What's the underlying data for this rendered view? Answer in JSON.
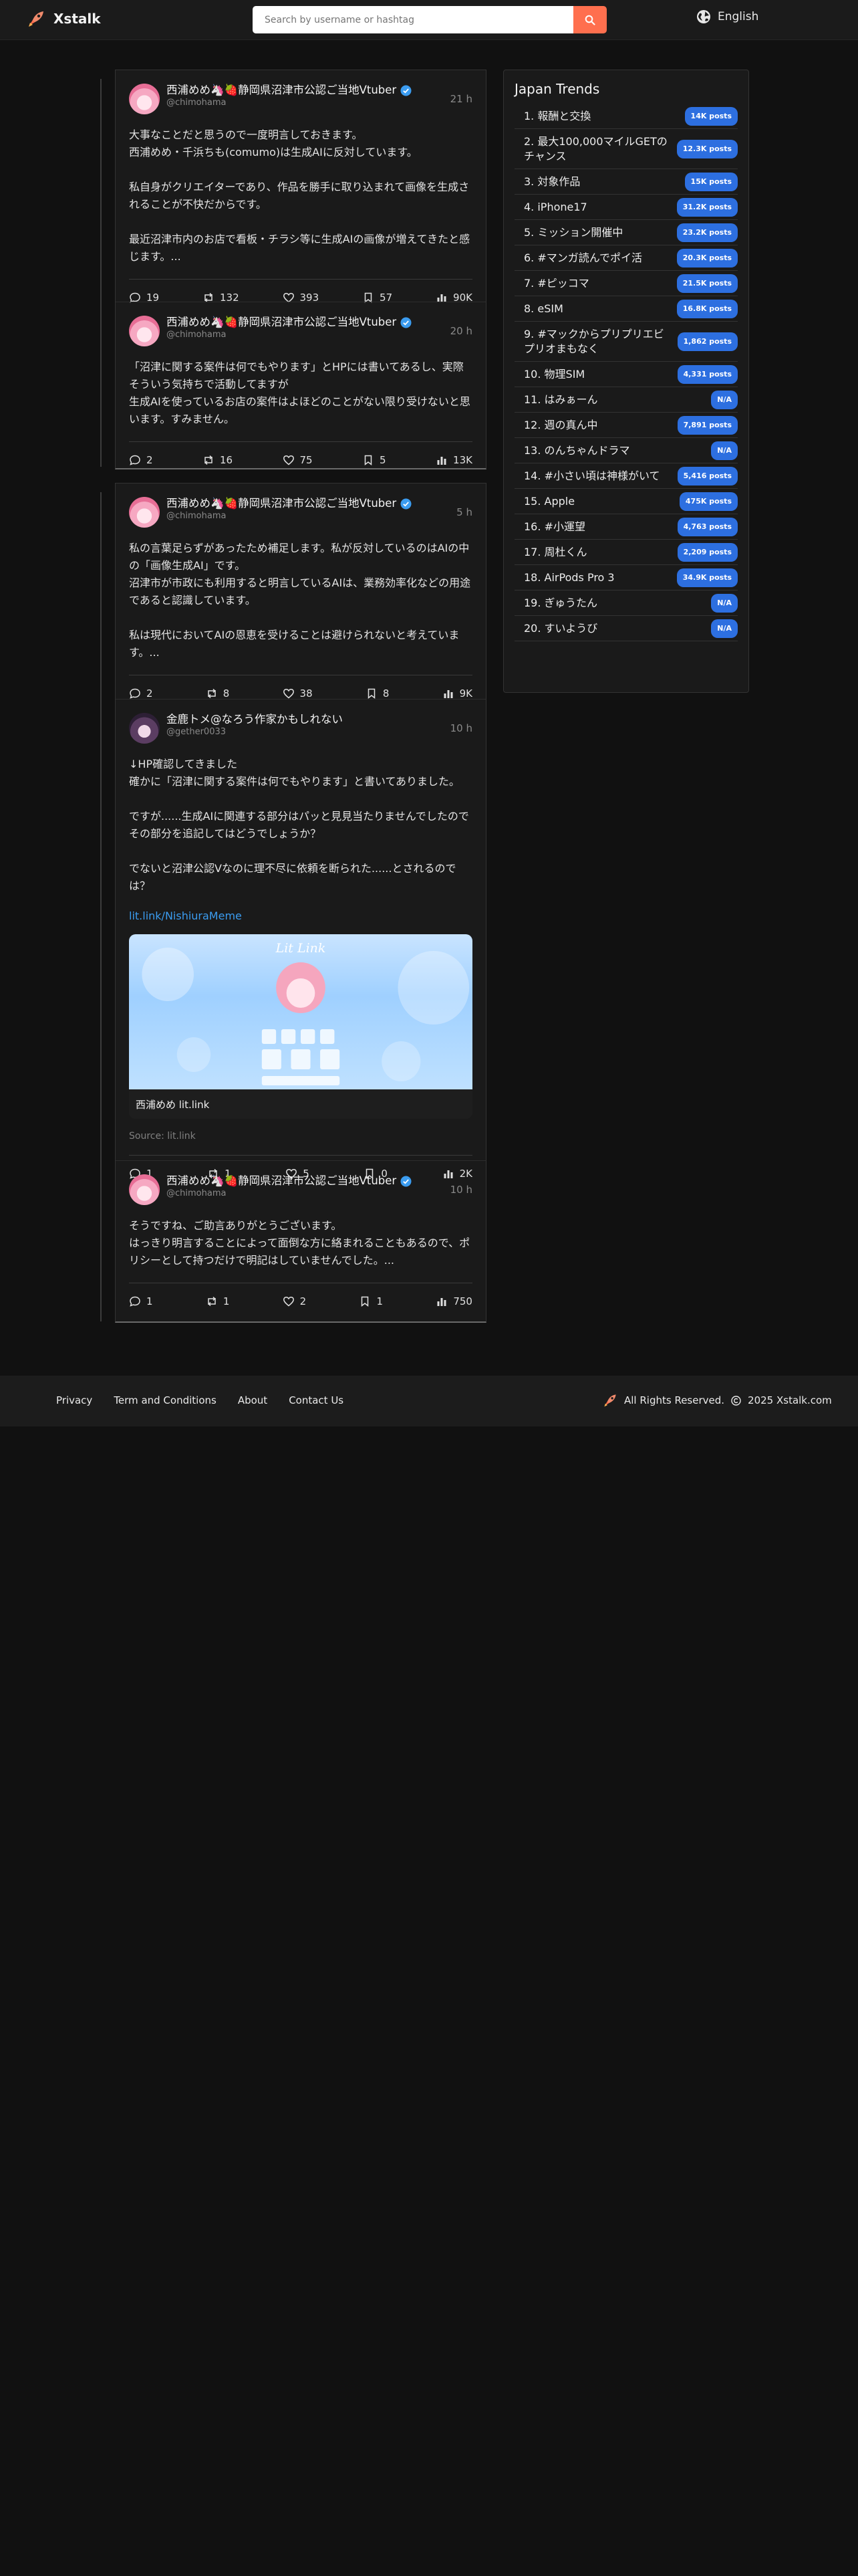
{
  "header": {
    "logo_text": "Xstalk",
    "search_placeholder": "Search by username or hashtag",
    "language": "English"
  },
  "threads": [
    {
      "posts": [
        {
          "name": "西浦めめ🦄🍓静岡県沼津市公認ご当地Vtuber",
          "handle": "@chimohama",
          "time": "21 h",
          "body": "大事なことだと思うので一度明言しておきます。\n西浦めめ・千浜ちも(comumo)は生成AIに反対しています。\n\n私自身がクリエイターであり、作品を勝手に取り込まれて画像を生成されることが不快だからです。\n\n最近沼津市内のお店で看板・チラシ等に生成AIの画像が増えてきたと感じます。...",
          "replies": "19",
          "reposts": "132",
          "likes": "393",
          "bookmarks": "57",
          "views": "90K"
        },
        {
          "name": "西浦めめ🦄🍓静岡県沼津市公認ご当地Vtuber",
          "handle": "@chimohama",
          "time": "20 h",
          "body": "「沼津に関する案件は何でもやります」とHPには書いてあるし、実際そういう気持ちで活動してますが\n生成AIを使っているお店の案件はよほどのことがない限り受けないと思います。すみません。",
          "replies": "2",
          "reposts": "16",
          "likes": "75",
          "bookmarks": "5",
          "views": "13K"
        }
      ]
    },
    {
      "posts": [
        {
          "name": "西浦めめ🦄🍓静岡県沼津市公認ご当地Vtuber",
          "handle": "@chimohama",
          "time": "5 h",
          "body": "私の言葉足らずがあったため補足します。私が反対しているのはAIの中の「画像生成AI」です。\n沼津市が市政にも利用すると明言しているAIは、業務効率化などの用途であると認識しています。\n\n私は現代においてAIの恩恵を受けることは避けられないと考えています。...",
          "replies": "2",
          "reposts": "8",
          "likes": "38",
          "bookmarks": "8",
          "views": "9K"
        },
        {
          "name": "金鹿トメ@なろう作家かもしれない",
          "handle": "@gether0033",
          "time": "10 h",
          "body": "↓HP確認してきました\n確かに「沼津に関する案件は何でもやります」と書いてありました。\n\nですが......生成AIに関連する部分はパッと見見当たりませんでしたのでその部分を追記してはどうでしょうか？\n\nでないと沼津公認Vなのに理不尽に依頼を断られた......とされるのでは？",
          "link": "lit.link/NishiuraMeme",
          "preview_caption": "西浦めめ lit.link",
          "preview_brand": "Lit Link",
          "source": "Source: lit.link",
          "replies": "1",
          "reposts": "1",
          "likes": "5",
          "bookmarks": "0",
          "views": "2K"
        },
        {
          "name": "西浦めめ🦄🍓静岡県沼津市公認ご当地Vtuber",
          "handle": "@chimohama",
          "time": "10 h",
          "body": "そうですね、ご助言ありがとうございます。\nはっきり明言することによって面倒な方に絡まれることもあるので、ポリシーとして持つだけで明記はしていませんでした。...",
          "replies": "1",
          "reposts": "1",
          "likes": "2",
          "bookmarks": "1",
          "views": "750"
        }
      ]
    }
  ],
  "trends": {
    "title": "Japan Trends",
    "items": [
      {
        "label": "1. 報酬と交換",
        "count": "14K posts"
      },
      {
        "label": "2. 最大100,000マイルGETのチャンス",
        "count": "12.3K posts"
      },
      {
        "label": "3. 対象作品",
        "count": "15K posts"
      },
      {
        "label": "4. iPhone17",
        "count": "31.2K posts"
      },
      {
        "label": "5. ミッション開催中",
        "count": "23.2K posts"
      },
      {
        "label": "6. #マンガ読んでポイ活",
        "count": "20.3K posts"
      },
      {
        "label": "7. #ピッコマ",
        "count": "21.5K posts"
      },
      {
        "label": "8. eSIM",
        "count": "16.8K posts"
      },
      {
        "label": "9. #マックからプリプリエビプリオまもなく",
        "count": "1,862 posts"
      },
      {
        "label": "10. 物理SIM",
        "count": "4,331 posts"
      },
      {
        "label": "11. はみぁーん",
        "count": "N/A"
      },
      {
        "label": "12. 週の真ん中",
        "count": "7,891 posts"
      },
      {
        "label": "13. のんちゃんドラマ",
        "count": "N/A"
      },
      {
        "label": "14. #小さい頃は神様がいて",
        "count": "5,416 posts"
      },
      {
        "label": "15. Apple",
        "count": "475K posts"
      },
      {
        "label": "16. #小運望",
        "count": "4,763 posts"
      },
      {
        "label": "17. 周杜くん",
        "count": "2,209 posts"
      },
      {
        "label": "18. AirPods Pro 3",
        "count": "34.9K posts"
      },
      {
        "label": "19. ぎゅうたん",
        "count": "N/A"
      },
      {
        "label": "20. すいようび",
        "count": "N/A"
      }
    ]
  },
  "footer": {
    "links": [
      "Privacy",
      "Term and Conditions",
      "About",
      "Contact Us"
    ],
    "copyright": "All Rights Reserved.",
    "copyright_tail": "2025 Xstalk.com"
  }
}
